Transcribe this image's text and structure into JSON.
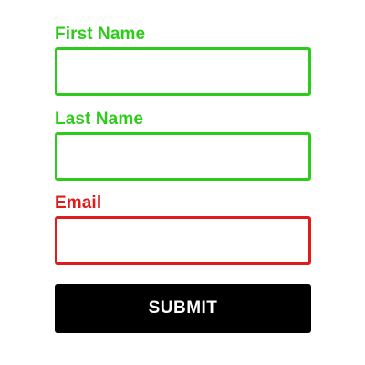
{
  "form": {
    "fields": [
      {
        "label": "First Name",
        "value": "",
        "placeholder": "",
        "status_color": "#2ecc1a"
      },
      {
        "label": "Last Name",
        "value": "",
        "placeholder": "",
        "status_color": "#2ecc1a"
      },
      {
        "label": "Email",
        "value": "",
        "placeholder": "",
        "status_color": "#e01b1b"
      }
    ],
    "submit_label": "SUBMIT"
  },
  "colors": {
    "valid": "#2ecc1a",
    "invalid": "#e01b1b",
    "button_background": "#000000",
    "button_text": "#ffffff"
  }
}
